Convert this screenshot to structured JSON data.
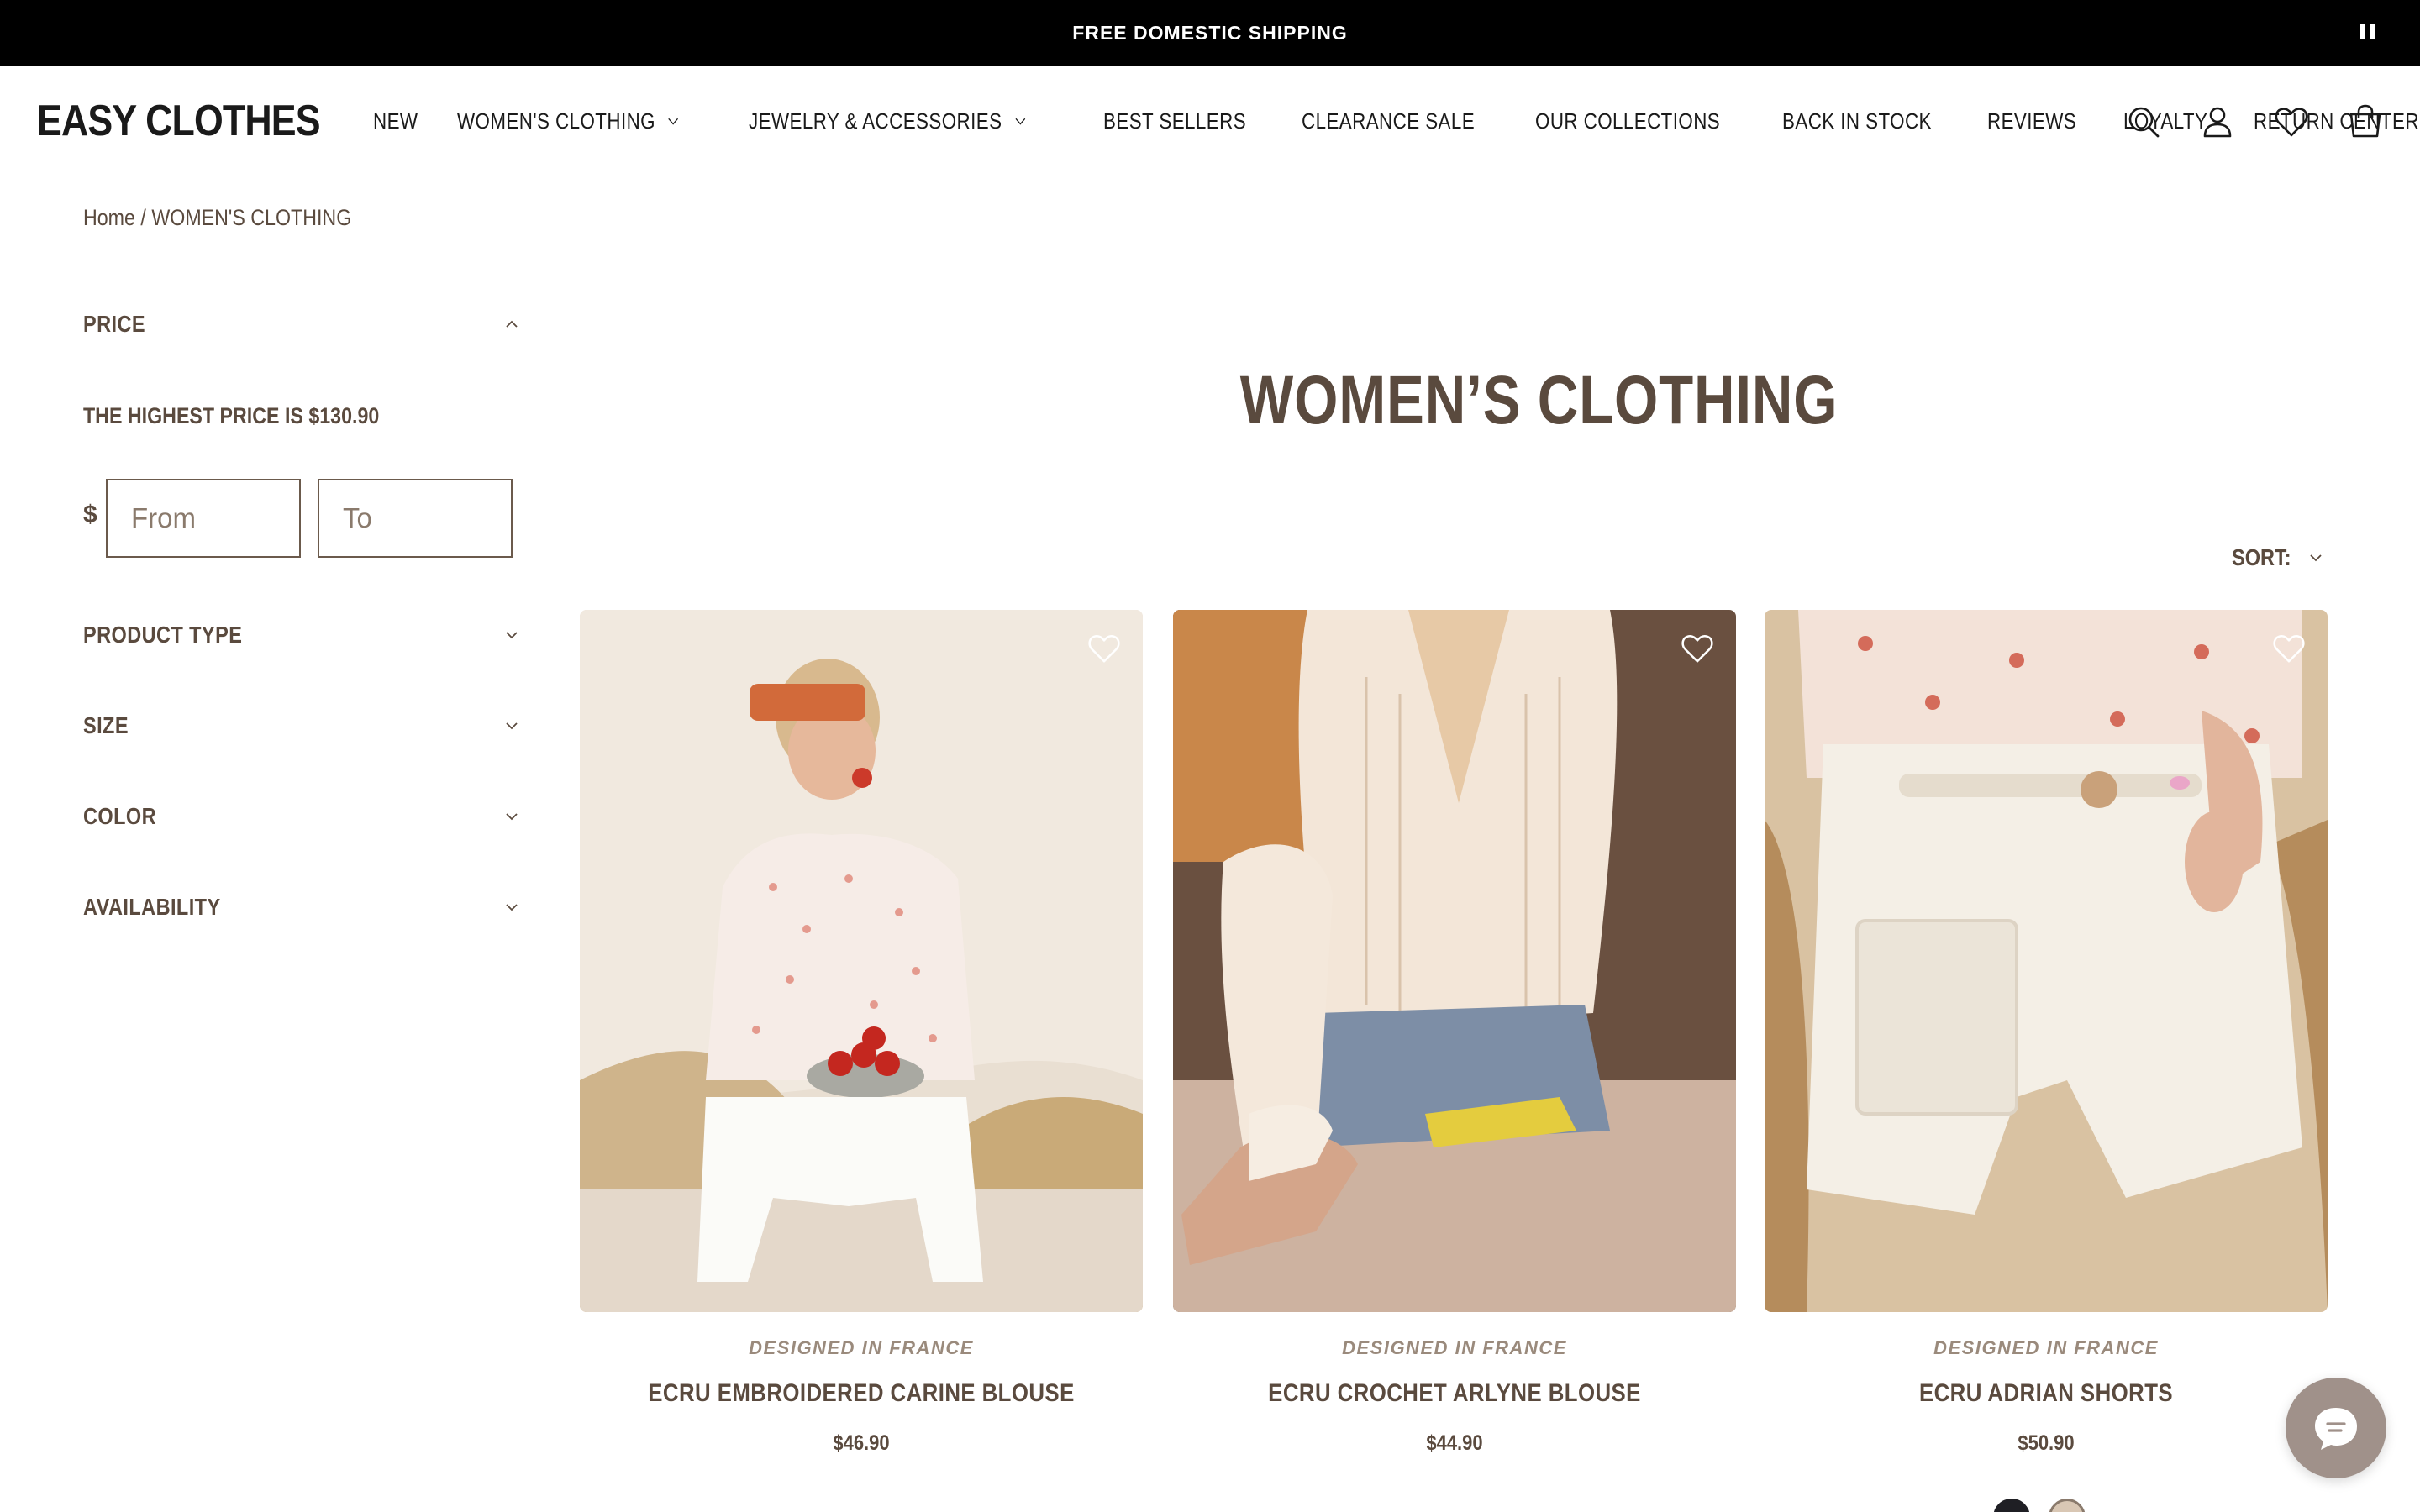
{
  "announcement": {
    "text": "FREE DOMESTIC SHIPPING",
    "pause_label": ""
  },
  "header": {
    "logo": "EASY CLOTHES",
    "nav": [
      {
        "label": "NEW",
        "has_dropdown": false
      },
      {
        "label": "WOMEN'S CLOTHING",
        "has_dropdown": true
      },
      {
        "label": "JEWELRY & ACCESSORIES",
        "has_dropdown": true
      },
      {
        "label": "BEST SELLERS",
        "has_dropdown": false
      },
      {
        "label": "CLEARANCE SALE",
        "has_dropdown": false
      },
      {
        "label": "OUR COLLECTIONS",
        "has_dropdown": false
      },
      {
        "label": "BACK IN STOCK",
        "has_dropdown": false
      },
      {
        "label": "REVIEWS",
        "has_dropdown": false
      },
      {
        "label": "LOYALTY",
        "has_dropdown": false
      },
      {
        "label": "RETURN CENTER",
        "has_dropdown": false
      }
    ],
    "icons": [
      "search-icon",
      "account-icon",
      "wishlist-icon",
      "cart-icon"
    ]
  },
  "breadcrumb": {
    "home": "Home",
    "separator": "/",
    "current": "WOMEN'S CLOTHING"
  },
  "filters": {
    "price": {
      "label": "PRICE",
      "highest_text": "THE HIGHEST PRICE IS $130.90",
      "currency": "$",
      "from_placeholder": "From",
      "to_placeholder": "To",
      "expanded": true
    },
    "collapsed": [
      {
        "label": "PRODUCT TYPE"
      },
      {
        "label": "SIZE"
      },
      {
        "label": "COLOR"
      },
      {
        "label": "AVAILABILITY"
      }
    ]
  },
  "main": {
    "title": "WOMEN’S CLOTHING",
    "sort_label": "SORT:"
  },
  "products": [
    {
      "tagline": "DESIGNED IN FRANCE",
      "name": "ECRU EMBROIDERED CARINE BLOUSE",
      "price": "$46.90"
    },
    {
      "tagline": "DESIGNED IN FRANCE",
      "name": "ECRU CROCHET ARLYNE BLOUSE",
      "price": "$44.90"
    },
    {
      "tagline": "DESIGNED IN FRANCE",
      "name": "ECRU ADRIAN SHORTS",
      "price": "$50.90"
    }
  ],
  "swatches": [
    "#1f1f24",
    "#d9c7b4"
  ],
  "colors": {
    "text_brown": "#5a4a3e",
    "announce_bg": "#000000",
    "chat_bg": "#a0918a"
  }
}
